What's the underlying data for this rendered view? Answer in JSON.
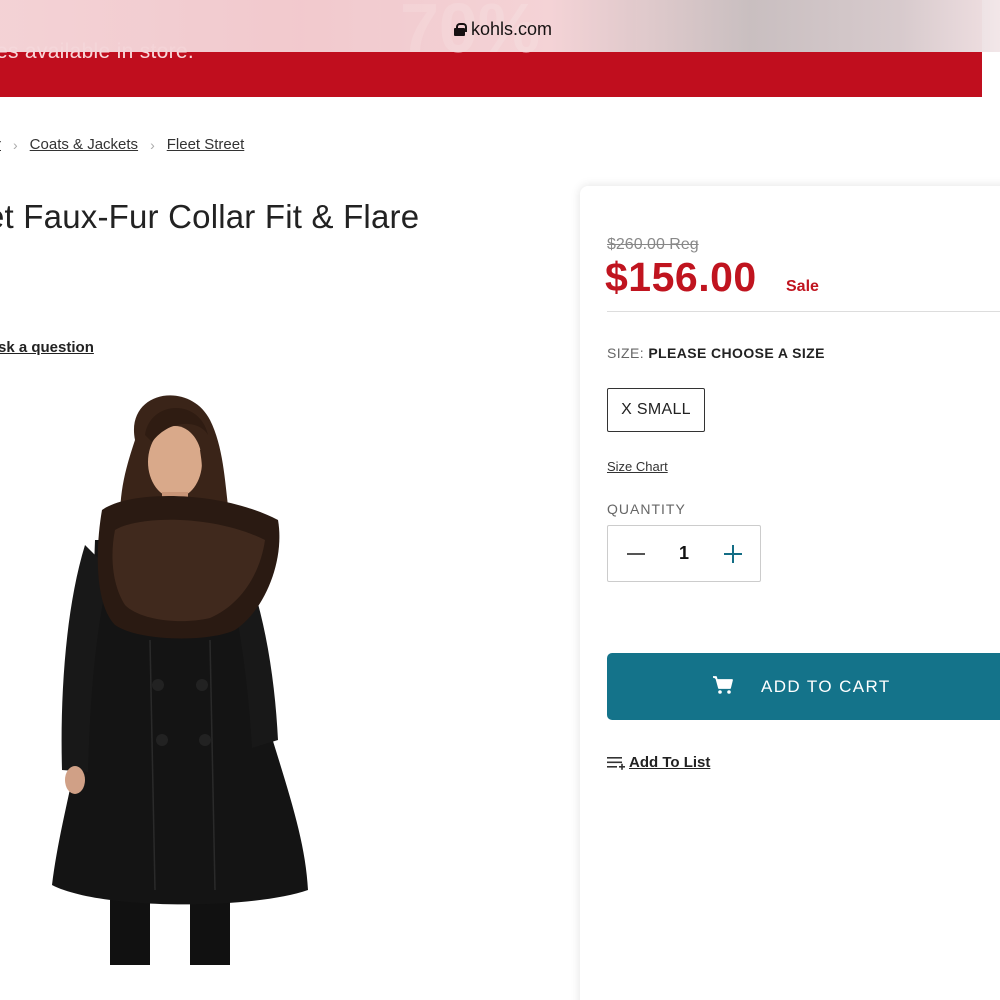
{
  "browser": {
    "url": "kohls.com"
  },
  "promo": {
    "text": "es available in store.",
    "big_text": "70%"
  },
  "breadcrumb": [
    {
      "label": "r"
    },
    {
      "label": "Coats & Jackets"
    },
    {
      "label": "Fleet Street"
    }
  ],
  "product": {
    "title": "et Faux-Fur Collar Fit & Flare",
    "ask_question": "sk a question"
  },
  "pricing": {
    "regular": "$260.00 Reg",
    "sale": "$156.00",
    "sale_label": "Sale"
  },
  "size": {
    "label": "SIZE:",
    "prompt": "PLEASE CHOOSE A SIZE",
    "options": [
      "X SMALL"
    ],
    "chart_link": "Size Chart"
  },
  "quantity": {
    "label": "QUANTITY",
    "value": "1"
  },
  "actions": {
    "add_to_cart": "ADD TO CART",
    "add_to_list": "Add To List"
  },
  "colors": {
    "brand_red": "#c0141f",
    "cart_teal": "#14738a",
    "promo_red": "#c00e1e"
  }
}
